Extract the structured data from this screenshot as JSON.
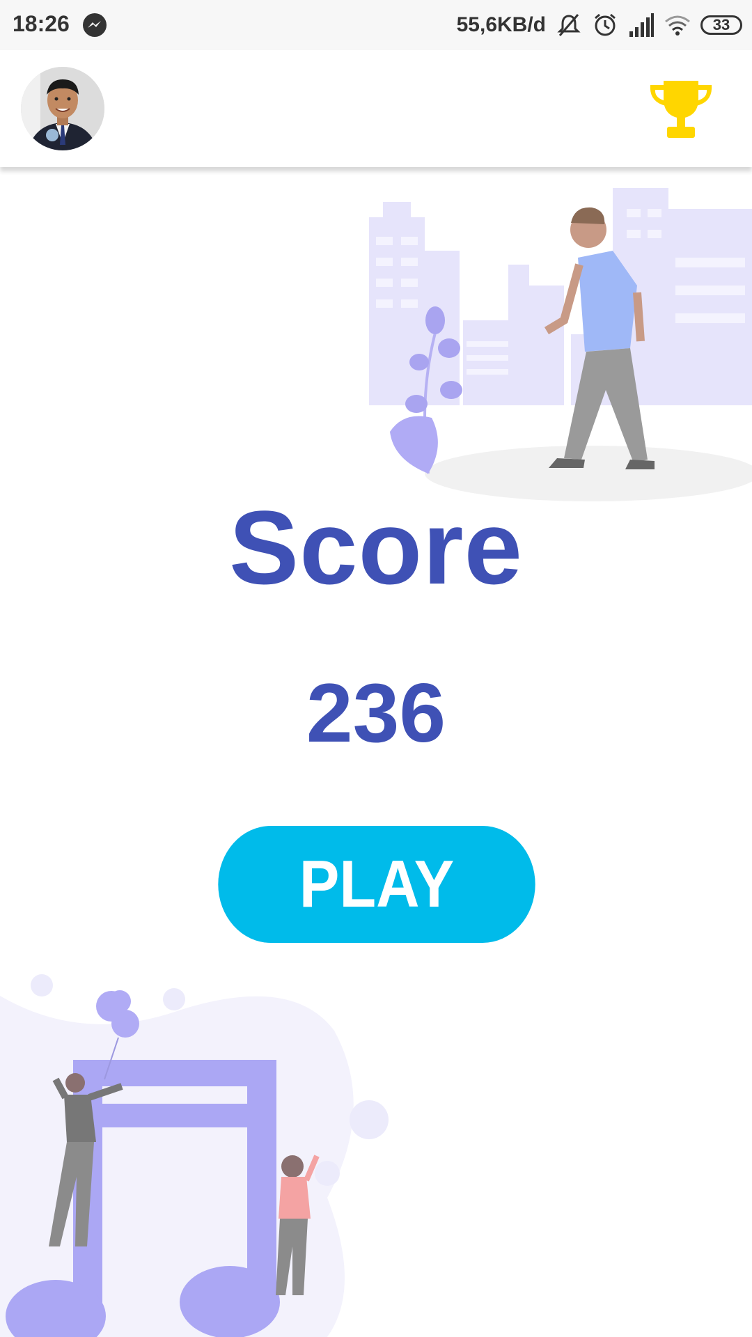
{
  "status_bar": {
    "time": "18:26",
    "network_speed": "55,6KB/d",
    "battery_level": "33",
    "icons": [
      "messenger-icon",
      "mute-bell-icon",
      "alarm-icon",
      "signal-icon",
      "wifi-icon",
      "battery-icon"
    ]
  },
  "app_bar": {
    "avatar": "profile-avatar",
    "trophy_icon": "trophy-icon",
    "trophy_color": "#ffd600"
  },
  "main": {
    "score_label": "Score",
    "score_value": "236",
    "play_label": "PLAY",
    "accent_color": "#3f51b5",
    "button_color": "#00bbea"
  }
}
